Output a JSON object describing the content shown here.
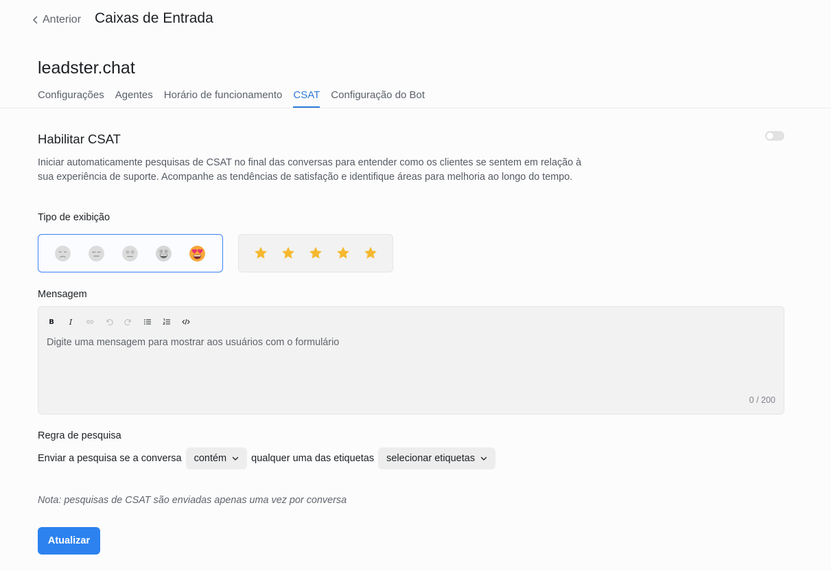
{
  "header": {
    "back_label": "Anterior",
    "title": "Caixas de Entrada"
  },
  "inbox": {
    "name": "leadster.chat"
  },
  "tabs": [
    {
      "label": "Configurações",
      "active": false
    },
    {
      "label": "Agentes",
      "active": false
    },
    {
      "label": "Horário de funcionamento",
      "active": false
    },
    {
      "label": "CSAT",
      "active": true
    },
    {
      "label": "Configuração do Bot",
      "active": false
    }
  ],
  "csat": {
    "title": "Habilitar CSAT",
    "enabled": false,
    "description": "Iniciar automaticamente pesquisas de CSAT no final das conversas para entender como os clientes se sentem em relação à sua experiência de suporte. Acompanhe as tendências de satisfação e identifique áreas para melhoria ao longo do tempo.",
    "display_type_label": "Tipo de exibição",
    "display_options": [
      {
        "type": "emoji",
        "selected": true,
        "icons": [
          "disappointed-face-icon",
          "expressionless-face-icon",
          "neutral-face-icon",
          "grinning-face-icon",
          "heart-eyes-face-icon"
        ]
      },
      {
        "type": "star",
        "selected": false,
        "icons": [
          "star-icon",
          "star-icon",
          "star-icon",
          "star-icon",
          "star-icon"
        ]
      }
    ],
    "message_label": "Mensagem",
    "editor": {
      "toolbar": [
        "bold-icon",
        "italic-icon",
        "link-icon",
        "undo-icon",
        "redo-icon",
        "bullet-list-icon",
        "numbered-list-icon",
        "code-icon"
      ],
      "placeholder": "Digite uma mensagem para mostrar aos usuários com o formulário",
      "char_count": "0 / 200"
    },
    "rule_label": "Regra de pesquisa",
    "rule": {
      "prefix": "Enviar a pesquisa se a conversa",
      "operator": "contém",
      "middle": "qualquer uma das etiquetas",
      "labels_placeholder": "selecionar etiquetas"
    },
    "note": "Nota: pesquisas de CSAT são enviadas apenas uma vez por conversa",
    "submit_label": "Atualizar"
  },
  "colors": {
    "accent": "#2d7ad6",
    "button": "#2d82f0",
    "selected_border": "#3b82f6",
    "star": "#f5b82e"
  }
}
